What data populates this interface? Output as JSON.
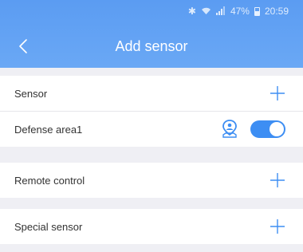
{
  "status_bar": {
    "icons": [
      "bluetooth-icon",
      "wifi-icon",
      "signal-icon"
    ],
    "battery": "47%",
    "time": "20:59"
  },
  "header": {
    "title": "Add sensor",
    "back_icon": "chevron-left-icon"
  },
  "sections": {
    "sensor": {
      "label": "Sensor",
      "add_icon": "plus-icon",
      "defense_area": {
        "label": "Defense area1",
        "location_icon": "location-pin-icon",
        "enabled": true
      }
    },
    "remote_control": {
      "label": "Remote control",
      "add_icon": "plus-icon"
    },
    "special_sensor": {
      "label": "Special sensor",
      "add_icon": "plus-icon"
    }
  },
  "colors": {
    "header": "#5b9cf2",
    "accent": "#3d8ef3",
    "background": "#efeff4"
  }
}
